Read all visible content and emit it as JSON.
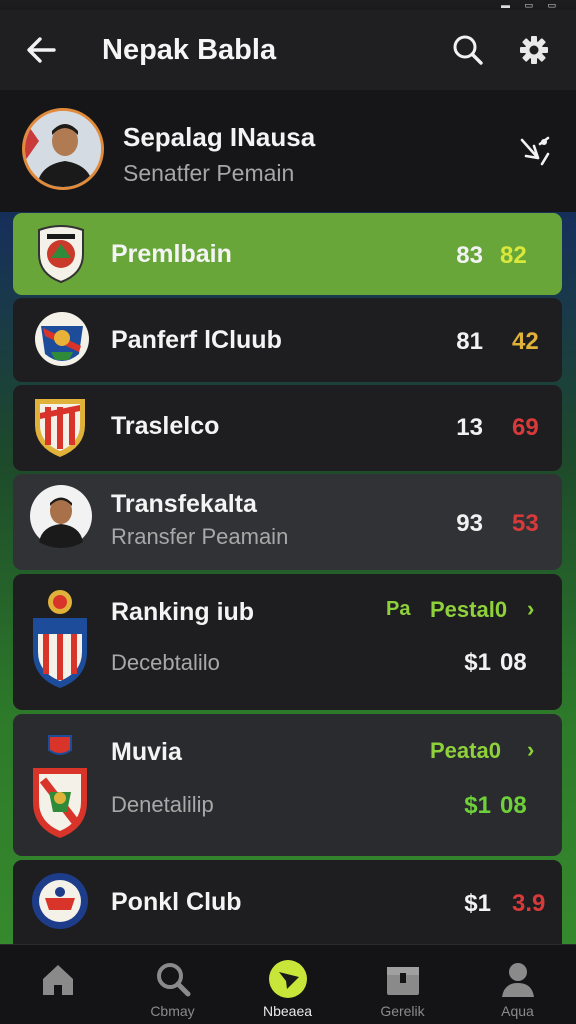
{
  "app_bar": {
    "title": "Nepak Babla"
  },
  "profile": {
    "name": "Sepalag INausa",
    "subtitle": "Senatfer Pemain"
  },
  "rows": [
    {
      "name": "Premlbain",
      "num_a": "83",
      "num_b": "82",
      "num_b_color": "#d9e83a"
    },
    {
      "name": "Panferf lCluub",
      "num_a": "81",
      "num_b": "42",
      "num_b_color": "#e0b23a"
    },
    {
      "name": "Traslelco",
      "num_a": "13",
      "num_b": "69",
      "num_b_color": "#d83a3a"
    },
    {
      "name": "Transfekalta",
      "subtitle": "Rransfer Peamain",
      "num_a": "93",
      "num_b": "53",
      "num_b_color": "#d83a3a"
    },
    {
      "name": "Ranking iub",
      "subtitle": "Decebtalilo",
      "link": "Pestal0",
      "link_prefix": "Pa",
      "num_a": "$1",
      "num_b": "08",
      "num_b_color": "#f2f2f2"
    },
    {
      "name": "Muvia",
      "subtitle": "Denetalilip",
      "link": "Peata0",
      "num_a": "$1",
      "num_b": "08",
      "num_b_color": "#6ed13a",
      "num_a_color": "#6ed13a"
    },
    {
      "name": "Ponkl Club",
      "num_a": "$1",
      "num_b": "3.9",
      "num_b_color": "#d83a3a"
    }
  ],
  "bottom_nav": [
    {
      "label": ""
    },
    {
      "label": "Cbmay"
    },
    {
      "label": "Nbeaea"
    },
    {
      "label": "Gerelik"
    },
    {
      "label": "Aqua"
    }
  ]
}
